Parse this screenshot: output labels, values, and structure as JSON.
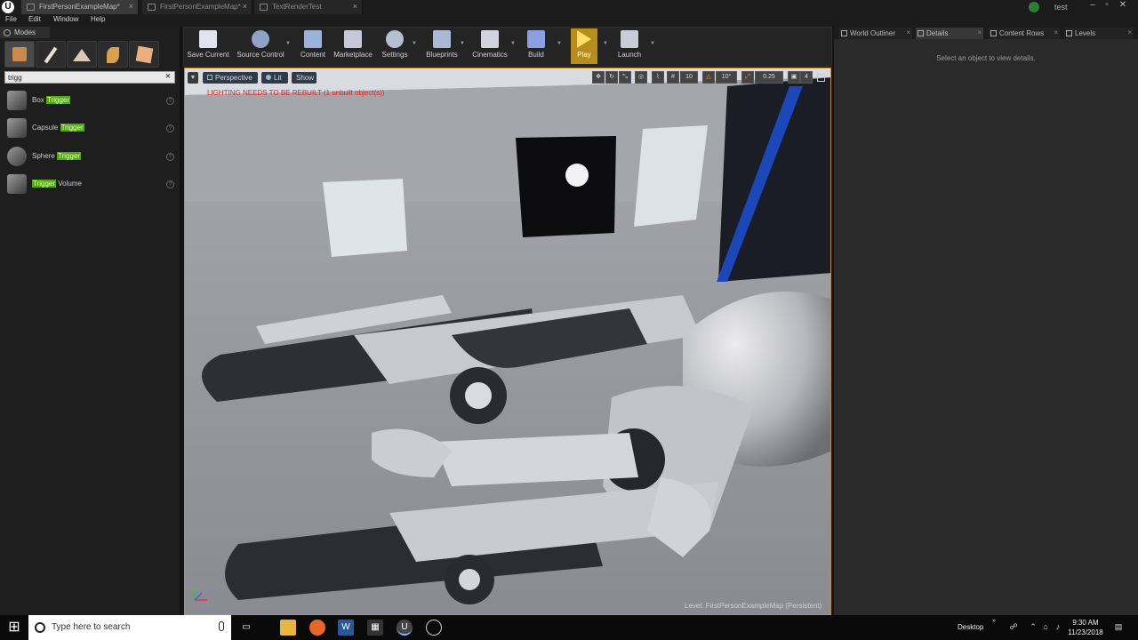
{
  "titlebar": {
    "tabs": [
      {
        "label": "FirstPersonExampleMap*"
      },
      {
        "label": "FirstPersonExampleMap*"
      },
      {
        "label": "TextRenderTest"
      }
    ],
    "user": "test"
  },
  "menu": [
    "File",
    "Edit",
    "Window",
    "Help"
  ],
  "modes": {
    "tab_label": "Modes",
    "search_value": "trigg",
    "items": [
      {
        "prefix": "Box ",
        "match": "Trigger",
        "suffix": ""
      },
      {
        "prefix": "Capsule ",
        "match": "Trigger",
        "suffix": ""
      },
      {
        "prefix": "Sphere ",
        "match": "Trigger",
        "suffix": ""
      },
      {
        "prefix": "",
        "match": "Trigger",
        "suffix": " Volume"
      }
    ]
  },
  "toolbar": {
    "buttons": [
      {
        "label": "Save Current",
        "icon": "save-icon"
      },
      {
        "label": "Source Control",
        "icon": "source-control-icon"
      },
      {
        "label": "Content",
        "icon": "content-icon"
      },
      {
        "label": "Marketplace",
        "icon": "marketplace-icon"
      },
      {
        "label": "Settings",
        "icon": "settings-icon"
      },
      {
        "label": "Blueprints",
        "icon": "blueprints-icon"
      },
      {
        "label": "Cinematics",
        "icon": "cinematics-icon"
      },
      {
        "label": "Build",
        "icon": "build-icon"
      },
      {
        "label": "Play",
        "icon": "play-icon"
      },
      {
        "label": "Launch",
        "icon": "launch-icon"
      }
    ]
  },
  "viewport": {
    "perspective": "Perspective",
    "lit": "Lit",
    "show": "Show",
    "grid_snap": "10",
    "rot_snap": "10°",
    "scale_snap": "0.25",
    "camera_speed": "4",
    "warning": "LIGHTING NEEDS TO BE REBUILT (1 unbuilt object(s))",
    "level": "Level:  FirstPersonExampleMap (Persistent)"
  },
  "right_panel": {
    "tabs": [
      "World Outliner",
      "Details",
      "Content Rows",
      "Levels"
    ],
    "hint": "Select an object to view details."
  },
  "taskbar": {
    "search_placeholder": "Type here to search",
    "desktop_label": "Desktop",
    "time": "9:30 AM",
    "date": "11/23/2018"
  },
  "colors": {
    "accent_play": "#b98d1d",
    "search_highlight": "#51a80f",
    "warning": "#e32020",
    "viewport_border": "#c78c28"
  }
}
